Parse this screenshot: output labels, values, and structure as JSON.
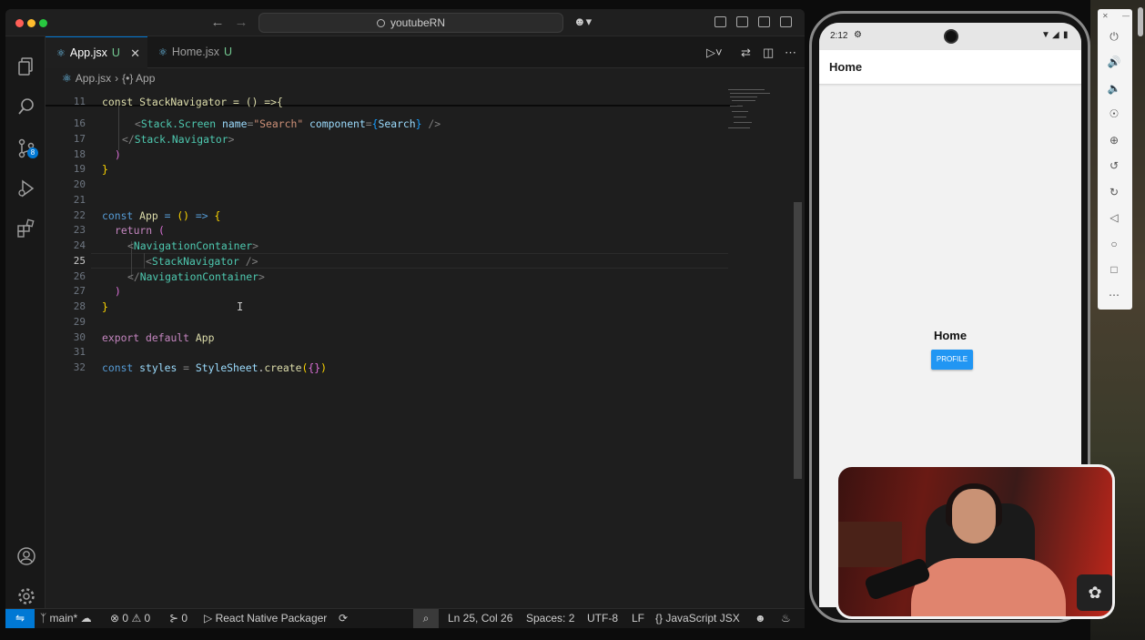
{
  "window": {
    "search_title": "youtubeRN"
  },
  "tabs": [
    {
      "label": "App.jsx",
      "modified": "U"
    },
    {
      "label": "Home.jsx",
      "modified": "U"
    }
  ],
  "breadcrumb": {
    "file": "App.jsx",
    "symbol": "{•} App"
  },
  "activity_badge": "8",
  "line_numbers": [
    "11",
    "16",
    "17",
    "18",
    "19",
    "20",
    "21",
    "22",
    "23",
    "24",
    "25",
    "26",
    "27",
    "28",
    "29",
    "30",
    "31",
    "32"
  ],
  "code": {
    "l11": "const StackNavigator = () =>{",
    "l16_tag": "Stack.Screen",
    "l16_name_attr": "name",
    "l16_name_val": "\"Search\"",
    "l16_comp_attr": "component",
    "l16_comp_val": "Search",
    "l17_tag": "Stack.Navigator",
    "l18": ")",
    "l19": "}",
    "l22_kw": "const",
    "l22_name": "App",
    "l23_kw": "return",
    "l24_tag": "NavigationContainer",
    "l25_tag": "StackNavigator",
    "l26_tag": "NavigationContainer",
    "l27": ")",
    "l28": "}",
    "l30_kw1": "export",
    "l30_kw2": "default",
    "l30_name": "App",
    "l32_kw": "const",
    "l32_name": "styles",
    "l32_obj": "StyleSheet",
    "l32_fn": "create"
  },
  "status": {
    "branch": "main*",
    "errors": "0",
    "warnings": "0",
    "ports": "0",
    "packager": "React Native Packager",
    "cursor": "Ln 25, Col 26",
    "spaces": "Spaces: 2",
    "encoding": "UTF-8",
    "eol": "LF",
    "language": "JavaScript JSX"
  },
  "phone": {
    "time": "2:12",
    "header_title": "Home",
    "screen_text": "Home",
    "button_label": "PROFILE",
    "button_color": "#2196f3"
  },
  "colors": {
    "accent": "#0078d4",
    "editor_bg": "#1e1e1e"
  }
}
